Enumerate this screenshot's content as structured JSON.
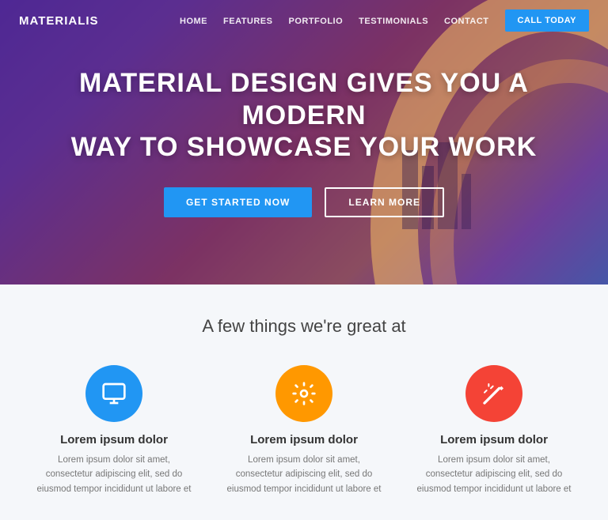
{
  "brand": "MATERIALIS",
  "nav": {
    "items": [
      {
        "label": "HOME"
      },
      {
        "label": "FEATURES"
      },
      {
        "label": "PORTFOLIO"
      },
      {
        "label": "TESTIMONIALS"
      },
      {
        "label": "CONTACT"
      }
    ],
    "cta_label": "CALL TODAY"
  },
  "hero": {
    "title_line1": "MATERIAL DESIGN GIVES YOU A MODERN",
    "title_line2": "WAY TO SHOWCASE YOUR WORK",
    "btn_primary": "GET STARTED NOW",
    "btn_outline": "LEARN MORE"
  },
  "features": {
    "heading": "A few things we're great at",
    "items": [
      {
        "title": "Lorem ipsum dolor",
        "desc": "Lorem ipsum dolor sit amet, consectetur adipiscing elit, sed do eiusmod tempor incididunt ut labore et",
        "color": "#2196F3",
        "icon": "monitor"
      },
      {
        "title": "Lorem ipsum dolor",
        "desc": "Lorem ipsum dolor sit amet, consectetur adipiscing elit, sed do eiusmod tempor incididunt ut labore et",
        "color": "#FF9800",
        "icon": "gear"
      },
      {
        "title": "Lorem ipsum dolor",
        "desc": "Lorem ipsum dolor sit amet, consectetur adipiscing elit, sed do eiusmod tempor incididunt ut labore et",
        "color": "#F44336",
        "icon": "wand"
      }
    ]
  }
}
